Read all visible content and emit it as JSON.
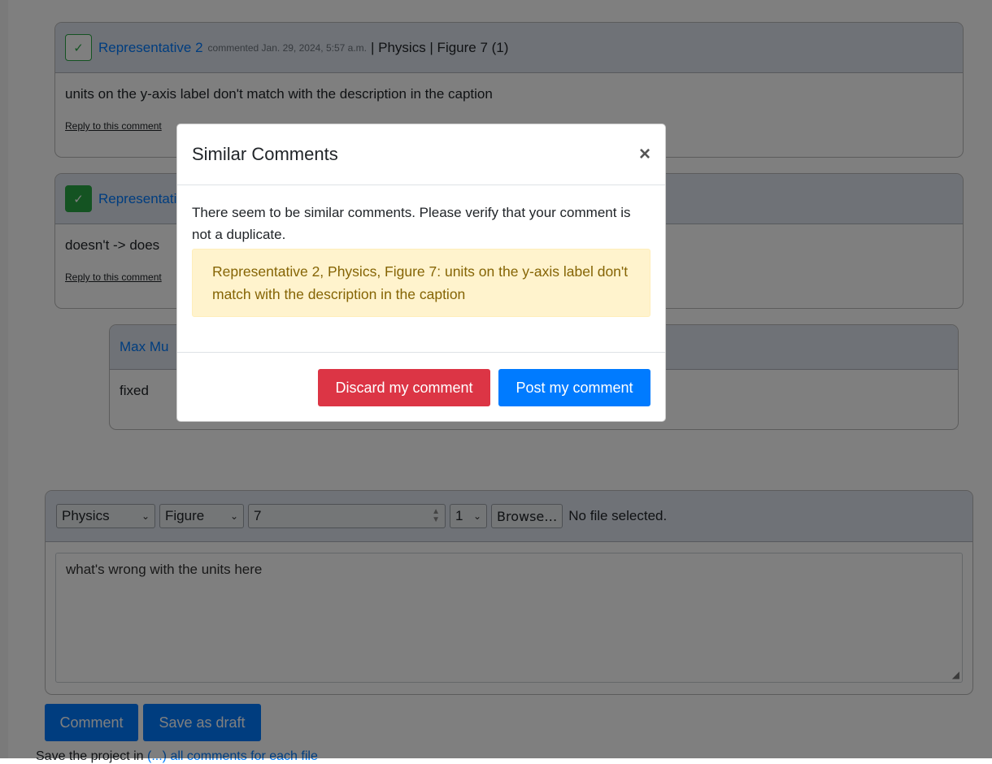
{
  "comments": [
    {
      "author": "Representative 2",
      "meta": "commented Jan. 29, 2024, 5:57 a.m.",
      "tail": "| Physics | Figure 7 (1)",
      "body": "units on the y-axis label don't match with the description in the caption",
      "reply": "Reply to this comment",
      "check": "✓"
    },
    {
      "author": "Representative",
      "body": "doesn't -> does",
      "reply": "Reply to this comment",
      "check": "✓"
    },
    {
      "author": "Max Mu",
      "body": "fixed"
    }
  ],
  "form": {
    "subject": "Physics",
    "type": "Figure",
    "number": "7",
    "index": "1",
    "browse": "Browse…",
    "file_status": "No file selected.",
    "text": "what's wrong with the units here",
    "comment_btn": "Comment",
    "draft_btn": "Save as draft"
  },
  "bottom": {
    "before": "Save the",
    "middle": "project",
    "after": "in",
    "link": "(...) all comments for each file"
  },
  "modal": {
    "title": "Similar Comments",
    "close": "×",
    "message": "There seem to be similar comments. Please verify that your comment is not a duplicate.",
    "alert": "Representative 2, Physics, Figure 7: units on the y-axis label don't match with the description in the caption",
    "discard": "Discard my comment",
    "post": "Post my comment"
  }
}
